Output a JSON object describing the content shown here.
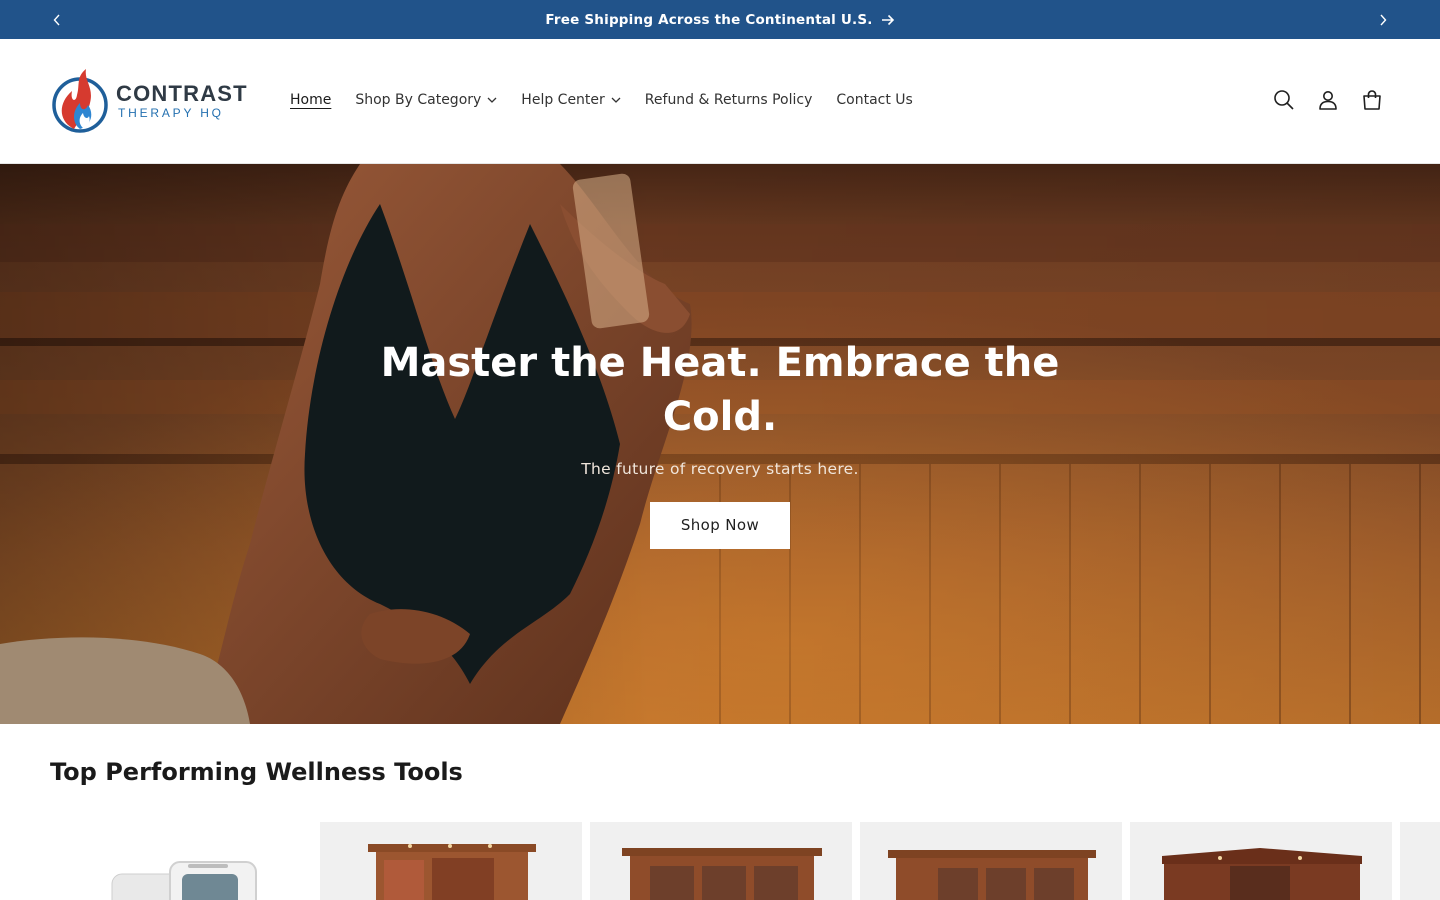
{
  "announcement": {
    "text": "Free Shipping Across the Continental U.S.",
    "bg_color": "#21538a"
  },
  "logo": {
    "line1": "CONTRAST",
    "line2": "THERAPY HQ"
  },
  "nav": {
    "items": [
      {
        "label": "Home",
        "active": true
      },
      {
        "label": "Shop By Category",
        "has_dropdown": true
      },
      {
        "label": "Help Center",
        "has_dropdown": true
      },
      {
        "label": "Refund & Returns Policy"
      },
      {
        "label": "Contact Us"
      }
    ]
  },
  "header_icons": [
    "search-icon",
    "account-icon",
    "cart-icon"
  ],
  "hero": {
    "title": "Master the Heat. Embrace the Cold.",
    "subtitle": "The future of recovery starts here.",
    "cta_label": "Shop Now"
  },
  "products_section": {
    "title": "Top Performing Wellness Tools"
  }
}
